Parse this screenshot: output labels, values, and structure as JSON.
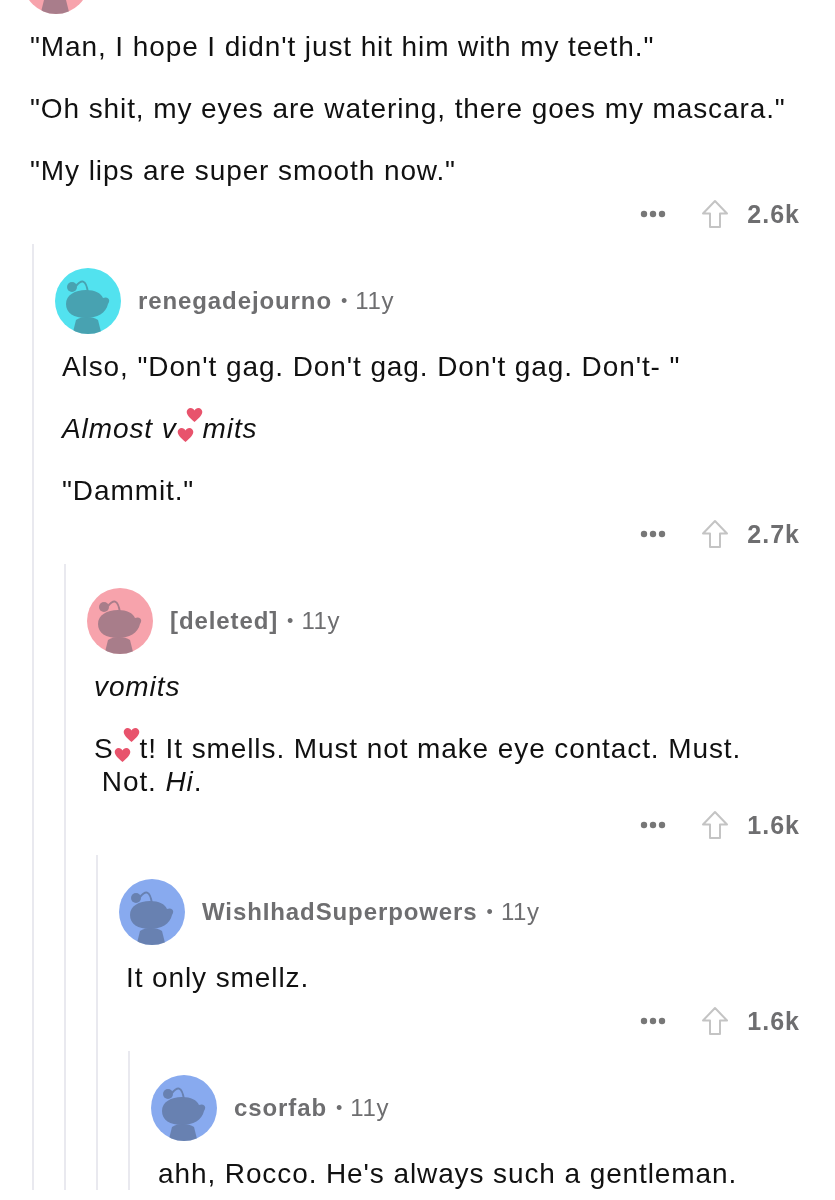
{
  "thread": [
    {
      "avatar": {
        "color": "#f7a3ac"
      },
      "body": [
        [
          {
            "kind": "text",
            "text": "\"Man, I hope I didn't just hit him with my teeth.\""
          }
        ],
        [
          {
            "kind": "text",
            "text": "\"Oh shit, my eyes are watering, there goes my mascara.\""
          }
        ],
        [
          {
            "kind": "text",
            "text": "\"My lips are super smooth now.\""
          }
        ]
      ],
      "votes": "2.6k",
      "replies": [
        {
          "avatar": {
            "color": "#52e2ef"
          },
          "author": "renegadejourno",
          "separator": "•",
          "age": "11y",
          "body": [
            [
              {
                "kind": "text",
                "text": "Also, \"Don't gag. Don't gag. Don't gag. Don't- \""
              }
            ],
            [
              {
                "kind": "text",
                "text": "Almost v",
                "italic": true
              },
              {
                "kind": "hearts"
              },
              {
                "kind": "text",
                "text": "mits",
                "italic": true
              }
            ],
            [
              {
                "kind": "text",
                "text": "\"Dammit.\""
              }
            ]
          ],
          "votes": "2.7k",
          "replies": [
            {
              "avatar": {
                "color": "#f7a3ac"
              },
              "author": "[deleted]",
              "separator": "•",
              "age": "11y",
              "body": [
                [
                  {
                    "kind": "text",
                    "text": "vomits",
                    "italic": true
                  }
                ],
                [
                  {
                    "kind": "text",
                    "text": "S"
                  },
                  {
                    "kind": "hearts"
                  },
                  {
                    "kind": "text",
                    "text": "t! It smells. Must not make eye contact. Must."
                  },
                  {
                    "kind": "text",
                    "text": "Not. *Hi*."
                  }
                ]
              ],
              "votes": "1.6k",
              "replies": [
                {
                  "avatar": {
                    "color": "#88aaef"
                  },
                  "author": "WishIhadSuperpowers",
                  "separator": "•",
                  "age": "11y",
                  "body": [
                    [
                      {
                        "kind": "text",
                        "text": "It only smellz."
                      }
                    ]
                  ],
                  "votes": "1.6k",
                  "replies": [
                    {
                      "avatar": {
                        "color": "#88aaef"
                      },
                      "author": "csorfab",
                      "separator": "•",
                      "age": "11y",
                      "body": [
                        [
                          {
                            "kind": "text",
                            "text": "ahh, Rocco. He's always such a gentleman."
                          }
                        ]
                      ]
                    }
                  ]
                }
              ]
            }
          ]
        }
      ]
    }
  ]
}
